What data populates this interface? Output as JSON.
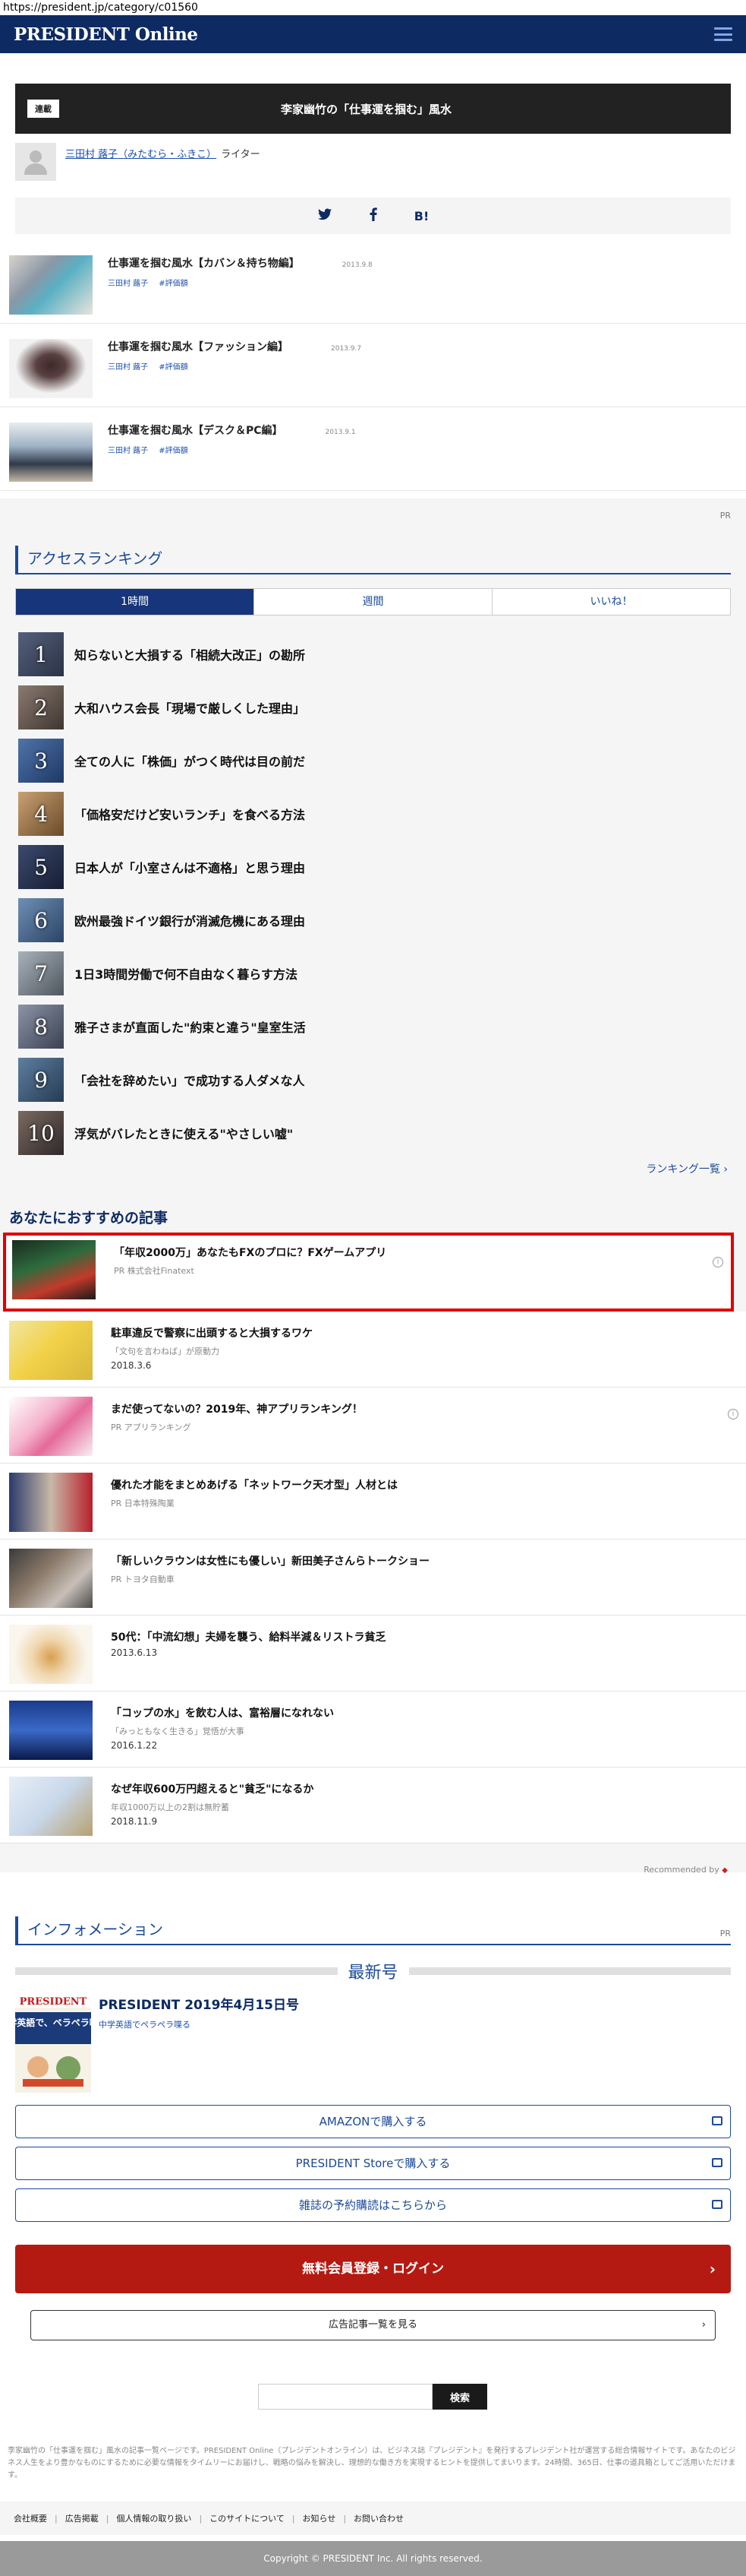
{
  "browser": {
    "url": "https://president.jp/category/c01560"
  },
  "header": {
    "logo": "PRESIDENT Online"
  },
  "series": {
    "badge": "連載",
    "title": "李家幽竹の「仕事運を掴む」風水",
    "author": "三田村 蕗子（みたむら・ふきこ）",
    "author_role": "ライター",
    "share": [
      "t",
      "f",
      "B!"
    ]
  },
  "series_items": [
    {
      "title": "仕事運を掴む風水【カバン＆持ち物編】",
      "date": "2013.9.8",
      "author": "三田村 蕗子",
      "tag": "#評価額"
    },
    {
      "title": "仕事運を掴む風水【ファッション編】",
      "date": "2013.9.7",
      "author": "三田村 蕗子",
      "tag": "#評価額"
    },
    {
      "title": "仕事運を掴む風水【デスク＆PC編】",
      "date": "2013.9.1",
      "author": "三田村 蕗子",
      "tag": "#評価額"
    }
  ],
  "ranking": {
    "pr": "PR",
    "heading": "アクセスランキング",
    "tabs": [
      "1時間",
      "週間",
      "いいね！"
    ],
    "items": [
      {
        "rank": "1",
        "title": "知らないと大損する「相続大改正」の勘所"
      },
      {
        "rank": "2",
        "title": "大和ハウス会長「現場で厳しくした理由」"
      },
      {
        "rank": "3",
        "title": "全ての人に「株価」がつく時代は目の前だ"
      },
      {
        "rank": "4",
        "title": "「価格安だけど安いランチ」を食べる方法"
      },
      {
        "rank": "5",
        "title": "日本人が「小室さんは不適格」と思う理由"
      },
      {
        "rank": "6",
        "title": "欧州最強ドイツ銀行が消滅危機にある理由"
      },
      {
        "rank": "7",
        "title": "1日3時間労働で何不自由なく暮らす方法"
      },
      {
        "rank": "8",
        "title": "雅子さまが直面した\"約束と違う\"皇室生活"
      },
      {
        "rank": "9",
        "title": "「会社を辞めたい」で成功する人ダメな人"
      },
      {
        "rank": "10",
        "title": "浮気がバレたときに使える\"やさしい嘘\""
      }
    ],
    "more": "ランキング一覧 ›"
  },
  "recommend": {
    "heading": "あなたにおすすめの記事",
    "items": [
      {
        "title": "「年収2000万」あなたもFXのプロに？FXゲームアプリ",
        "sub": "PR 株式会社Finatext",
        "date": ""
      },
      {
        "title": "駐車違反で警察に出頭すると大損するワケ",
        "sub": "「文句を言わねば」が原動力",
        "date": "2018.3.6"
      },
      {
        "title": "まだ使ってないの？2019年、神アプリランキング！",
        "sub": "PR アプリランキング",
        "date": ""
      },
      {
        "title": "優れた才能をまとめあげる「ネットワーク天才型」人材とは",
        "sub": "PR 日本特殊陶業",
        "date": ""
      },
      {
        "title": "「新しいクラウンは女性にも優しい」新田美子さんらトークショー",
        "sub": "PR トヨタ自動車",
        "date": ""
      },
      {
        "title": "50代：「中流幻想」夫婦を襲う、給料半減＆リストラ貧乏",
        "sub": "",
        "date": "2013.6.13"
      },
      {
        "title": "「コップの水」を飲む人は、富裕層になれない",
        "sub": "「みっともなく生きる」覚悟が大事",
        "date": "2016.1.22"
      },
      {
        "title": "なぜ年収600万円超えると\"貧乏\"になるか",
        "sub": "年収1000万以上の2割は無貯蓄",
        "date": "2018.11.9"
      }
    ],
    "recommended_by": "Recommended by"
  },
  "info": {
    "heading": "インフォメーション",
    "pr": "PR",
    "latest_label": "最新号",
    "magazine_title": "PRESIDENT 2019年4月15日号",
    "magazine_sub": "中学英語でペラペラ喋る",
    "cover_brand": "PRESIDENT",
    "cover_text": "中学英語で、ペラペラ喋る",
    "buy_amazon": "AMAZONで購入する",
    "buy_store": "PRESIDENT Storeで購入する",
    "subscribe": "雑誌の予約購読はこちらから",
    "register": "無料会員登録・ログイン",
    "ad_list": "広告記事一覧を見る"
  },
  "search": {
    "placeholder": "",
    "button": "検索"
  },
  "footnote": "李家幽竹の「仕事運を掴む」風水の記事一覧ページです。PRESIDENT Online（プレジデントオンライン）は、ビジネス誌『プレジデント』を発行するプレジデント社が運営する総合情報サイトです。あなたのビジネス人生をより豊かなものにするために必要な情報をタイムリーにお届けし、戦略の悩みを解決し、理想的な働き方を実現するヒントを提供してまいります。24時間、365日、仕事の道具箱としてご活用いただけます。",
  "footer": {
    "links": [
      "会社概要",
      "広告掲載",
      "個人情報の取り扱い",
      "このサイトについて",
      "お知らせ",
      "お問い合わせ"
    ],
    "copyright": "Copyright © PRESIDENT Inc. All rights reserved."
  }
}
